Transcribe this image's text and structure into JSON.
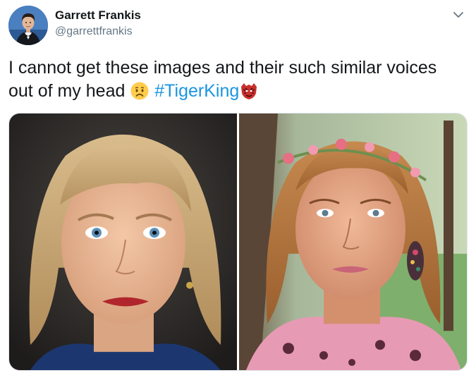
{
  "tweet": {
    "author": {
      "display_name": "Garrett Frankis",
      "handle": "@garrettfrankis",
      "avatar_icon": "profile-photo"
    },
    "text": {
      "line1": "I cannot get these images and their such similar voices",
      "line2_start": "out of my head ",
      "emoji_1": "worried-face-emoji",
      "hashtag": "#TigerKing",
      "emoji_2": "tiger-hashflag-emoji"
    },
    "menu_icon": "chevron-down-icon",
    "media": [
      {
        "description_icon": "portrait-photo-left"
      },
      {
        "description_icon": "portrait-photo-right"
      }
    ],
    "colors": {
      "hashtag": "#1b95e0",
      "text": "#14171a",
      "secondary": "#657786"
    }
  }
}
